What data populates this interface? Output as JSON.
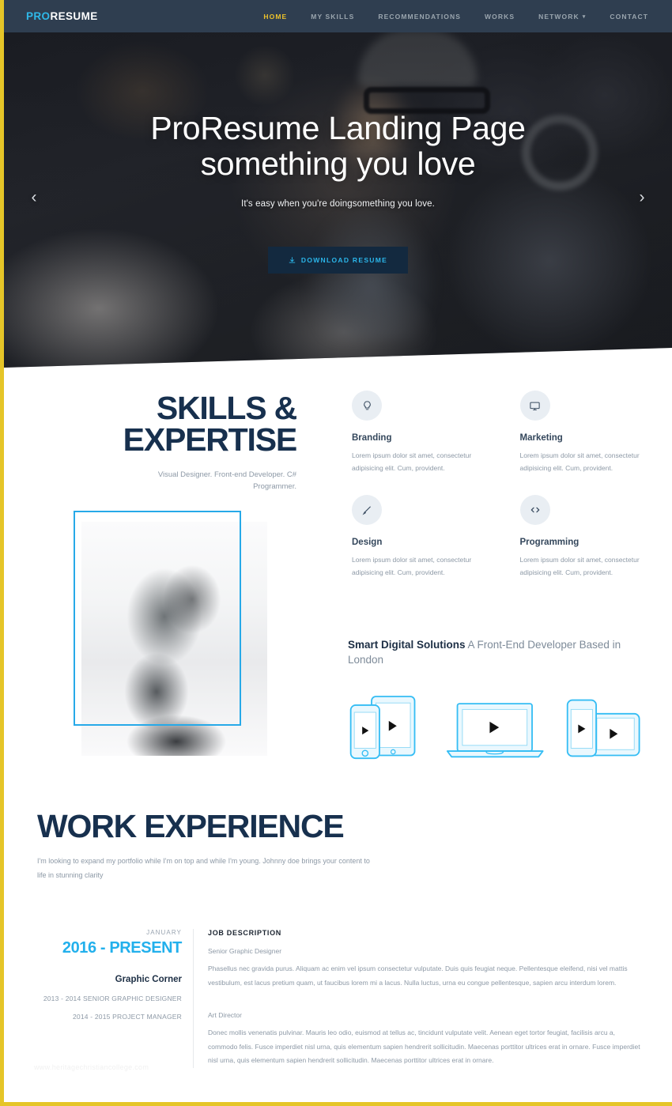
{
  "brand": {
    "pro": "PRO",
    "resume": "RESUME"
  },
  "nav": {
    "items": [
      {
        "label": "HOME",
        "active": true
      },
      {
        "label": "MY SKILLS",
        "active": false
      },
      {
        "label": "RECOMMENDATIONS",
        "active": false
      },
      {
        "label": "WORKS",
        "active": false
      },
      {
        "label": "NETWORK",
        "active": false,
        "caret": "▾"
      },
      {
        "label": "CONTACT",
        "active": false
      }
    ]
  },
  "hero": {
    "title_line1": "ProResume Landing Page",
    "title_line2": "something you love",
    "subtitle": "It's easy when you're doingsomething you love.",
    "button_label": "DOWNLOAD RESUME",
    "prev_arrow": "‹",
    "next_arrow": "›"
  },
  "skills": {
    "heading_line1": "SKILLS &",
    "heading_line2": "EXPERTISE",
    "subtitle": "Visual Designer. Front-end Developer. C# Programmer.",
    "items": [
      {
        "icon": "lightbulb-icon",
        "title": "Branding",
        "desc": "Lorem ipsum dolor sit amet, consectetur adipisicing elit. Cum, provident."
      },
      {
        "icon": "monitor-icon",
        "title": "Marketing",
        "desc": "Lorem ipsum dolor sit amet, consectetur adipisicing elit. Cum, provident."
      },
      {
        "icon": "brush-icon",
        "title": "Design",
        "desc": "Lorem ipsum dolor sit amet, consectetur adipisicing elit. Cum, provident."
      },
      {
        "icon": "code-icon",
        "title": "Programming",
        "desc": "Lorem ipsum dolor sit amet, consectetur adipisicing elit. Cum, provident."
      }
    ],
    "smart_bold": "Smart Digital Solutions",
    "smart_rest": " A Front-End Developer Based in London"
  },
  "work": {
    "heading": "WORK EXPERIENCE",
    "subtitle": "I'm looking to expand my portfolio while I'm on top and while I'm young. Johnny doe brings your content to life in stunning clarity",
    "month": "JANUARY",
    "years": "2016 - PRESENT",
    "company": "Graphic Corner",
    "role1": "2013 - 2014 SENIOR GRAPHIC DESIGNER",
    "role2": "2014 - 2015 PROJECT MANAGER",
    "jd_heading": "JOB DESCRIPTION",
    "jd_role1": "Senior Graphic Designer",
    "jd_text1": "Phasellus nec gravida purus. Aliquam ac enim vel ipsum consectetur vulputate. Duis quis feugiat neque. Pellentesque eleifend, nisi vel mattis vestibulum, est lacus pretium quam, ut faucibus lorem mi a lacus. Nulla luctus, urna eu congue pellentesque, sapien arcu interdum lorem.",
    "jd_role2": "Art Director",
    "jd_text2": "Donec mollis venenatis pulvinar. Mauris leo odio, euismod at tellus ac, tincidunt vulputate velit. Aenean eget tortor feugiat, facilisis arcu a, commodo felis. Fusce imperdiet nisl urna, quis elementum sapien hendrerit sollicitudin. Maecenas porttitor ultrices erat in ornare. Fusce imperdiet nisl urna, quis elementum sapien hendrerit sollicitudin. Maecenas porttitor ultrices erat in ornare."
  },
  "watermark": "www.heritagechristiancollege.com",
  "colors": {
    "header_bg": "#2f3e50",
    "accent_yellow": "#e5c528",
    "accent_cyan": "#22b0ec",
    "navy": "#17304e",
    "muted": "#8d99a6",
    "page_border": "#e5c528"
  }
}
